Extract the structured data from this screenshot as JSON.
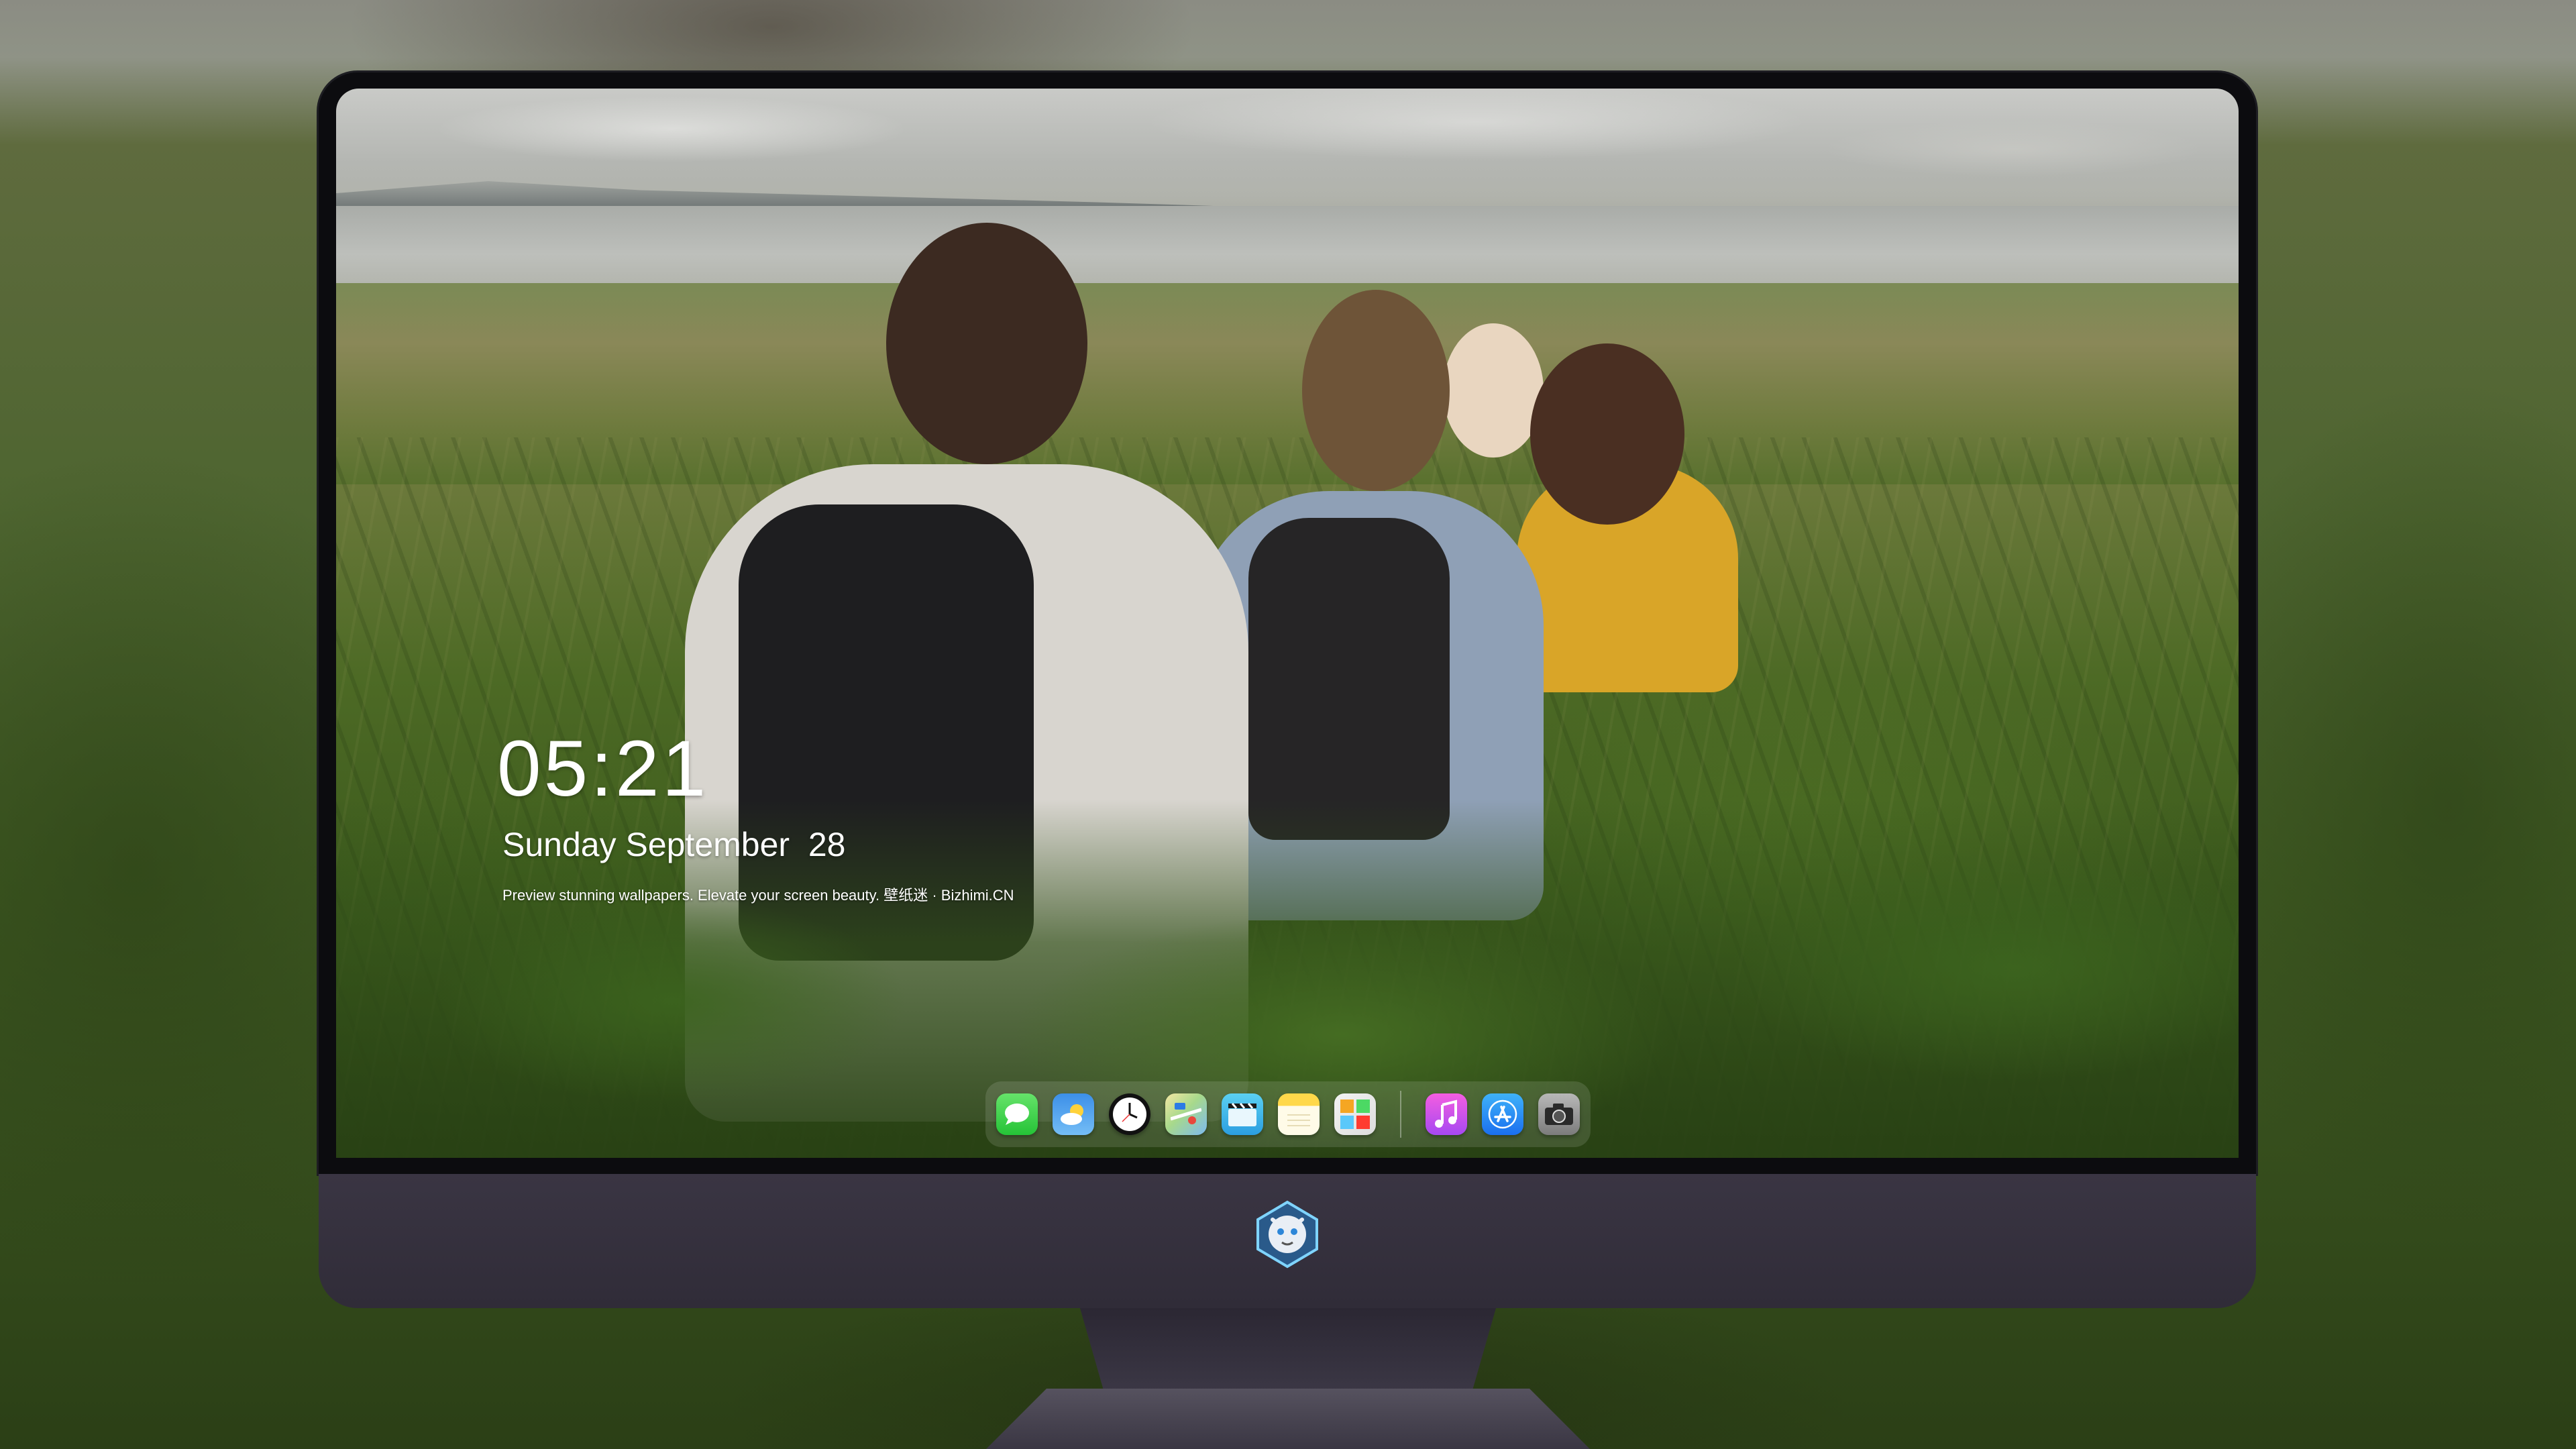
{
  "lock_screen": {
    "time": "05:21",
    "date": "Sunday September  28",
    "tagline": "Preview stunning wallpapers. Elevate your screen beauty. 壁纸迷 · Bizhimi.CN"
  },
  "dock": {
    "apps": [
      {
        "name": "messages-icon"
      },
      {
        "name": "weather-icon"
      },
      {
        "name": "clock-icon"
      },
      {
        "name": "maps-icon"
      },
      {
        "name": "clips-icon"
      },
      {
        "name": "notes-icon"
      },
      {
        "name": "photos-icon"
      },
      {
        "name": "music-icon"
      },
      {
        "name": "app-store-icon"
      },
      {
        "name": "camera-icon"
      }
    ]
  },
  "colors": {
    "bezel": "#0c0c0f",
    "chin": "#3a3543",
    "text": "#ffffff"
  }
}
